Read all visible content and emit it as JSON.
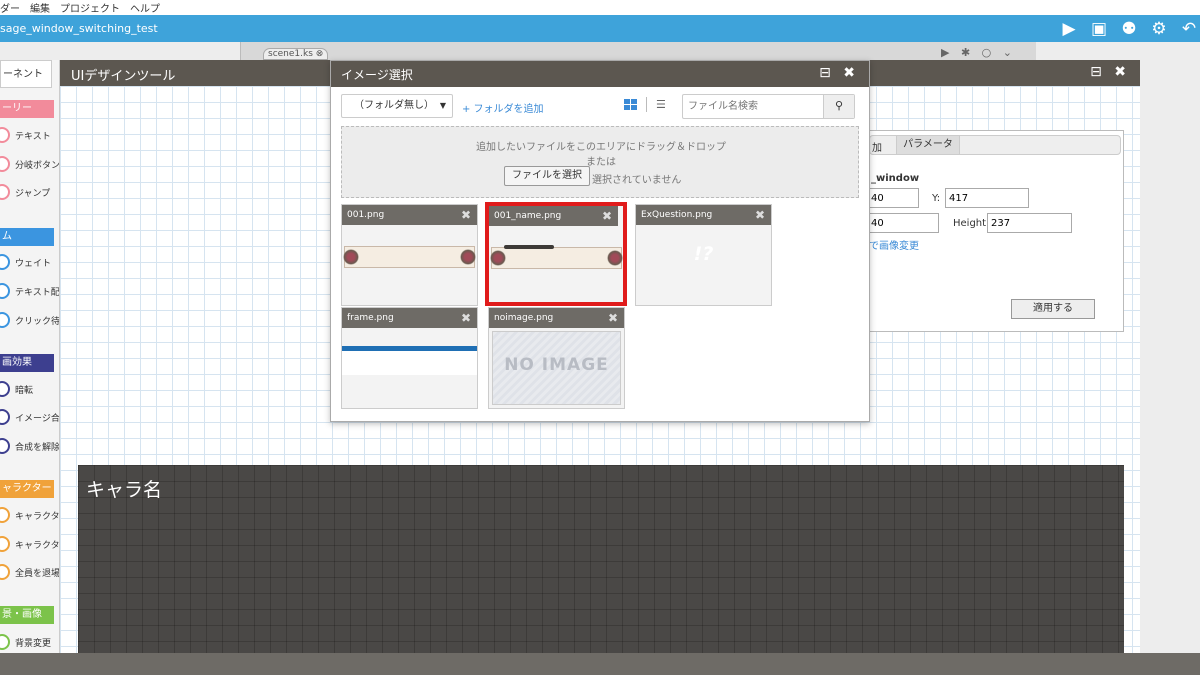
{
  "menu": [
    "ダー",
    "編集",
    "プロジェクト",
    "ヘルプ"
  ],
  "window": {
    "title": "sage_window_switching_test",
    "icons": [
      "play-icon",
      "save-icon",
      "users-icon",
      "gear-icon",
      "undo-icon"
    ]
  },
  "scene_tab": {
    "label": "scene1.ks ⊗",
    "tools": "▶ ✱ ○ ⌄"
  },
  "sidebar": {
    "tab": "ーネント",
    "categories": [
      {
        "label": "ーリー",
        "color": "#f28b9b",
        "items": [
          "テキスト",
          "分岐ボタン",
          "ジャンプ"
        ]
      },
      {
        "label": "ム",
        "color": "#3b95e0",
        "items": [
          "ウェイト",
          "テキスト配置",
          "クリック待ち"
        ]
      },
      {
        "label": "画効果",
        "color": "#3d3f8f",
        "items": [
          "暗転",
          "イメージ合成",
          "合成を解除"
        ]
      },
      {
        "label": "ャラクター",
        "color": "#f0a23a",
        "items": [
          "キャラクター",
          "キャラクター",
          "全員を退場"
        ]
      },
      {
        "label": "景・画像",
        "color": "#7cc34a",
        "items": [
          "背景変更"
        ]
      }
    ]
  },
  "ui_tool": {
    "title": "UIデザインツール",
    "controls": "⊟ ✖",
    "props": {
      "tab_add": "加",
      "tab_param": "パラメータ",
      "name": "_window",
      "y_label": "Y:",
      "y_value": "417",
      "x_value": "40",
      "height_label": "Height:",
      "height_value": "237",
      "image_link": "で画像変更",
      "apply": "適用する"
    },
    "preview_name": "キャラ名"
  },
  "image_dialog": {
    "title": "イメージ選択",
    "controls": "⊟ ✖",
    "folder_select": "（フォルダ無し）",
    "add_folder": "+ フォルダを追加",
    "search_placeholder": "ファイル名検索",
    "drop_text": "追加したいファイルをこのエリアにドラッグ＆ドロップ",
    "or_text": "または",
    "choose_file": "ファイルを選択",
    "no_file": "選択されていません",
    "files": [
      {
        "name": "001.png",
        "selected": false
      },
      {
        "name": "001_name.png",
        "selected": true
      },
      {
        "name": "ExQuestion.png",
        "selected": false,
        "preview_text": "!?"
      },
      {
        "name": "frame.png",
        "selected": false
      },
      {
        "name": "noimage.png",
        "selected": false,
        "preview_text": "NO IMAGE"
      }
    ]
  },
  "colors": {
    "accent": "#3ea3da",
    "header": "#5c5750",
    "selection": "#e01b1b"
  }
}
